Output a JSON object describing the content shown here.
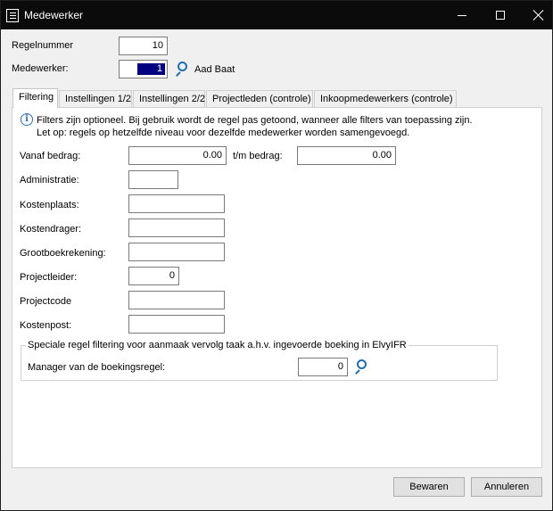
{
  "window": {
    "title": "Medewerker"
  },
  "header": {
    "regelnummer_label": "Regelnummer",
    "regelnummer_value": "10",
    "medewerker_label": "Medewerker:",
    "medewerker_value": "1",
    "medewerker_name": "Aad Baat"
  },
  "tabs": [
    {
      "label": "Filtering",
      "active": true
    },
    {
      "label": "Instellingen 1/2"
    },
    {
      "label": "Instellingen 2/2"
    },
    {
      "label": "Projectleden (controle)"
    },
    {
      "label": "Inkoopmedewerkers (controle)"
    }
  ],
  "info": {
    "line1": "Filters zijn optioneel. Bij gebruik wordt de regel pas getoond, wanneer alle filters van toepassing zijn.",
    "line2": "Let op: regels op hetzelfde niveau voor dezelfde medewerker worden samengevoegd."
  },
  "form": {
    "vanaf_bedrag_label": "Vanaf bedrag:",
    "vanaf_bedrag_value": "0.00",
    "tm_bedrag_label": "t/m bedrag:",
    "tm_bedrag_value": "0.00",
    "administratie_label": "Administratie:",
    "administratie_value": "",
    "kostenplaats_label": "Kostenplaats:",
    "kostenplaats_value": "",
    "kostendrager_label": "Kostendrager:",
    "kostendrager_value": "",
    "grootboekrekening_label": "Grootboekrekening:",
    "grootboekrekening_value": "",
    "projectleider_label": "Projectleider:",
    "projectleider_value": "0",
    "projectcode_label": "Projectcode",
    "projectcode_value": "",
    "kostenpost_label": "Kostenpost:",
    "kostenpost_value": ""
  },
  "special": {
    "group_title": "Speciale regel filtering voor aanmaak vervolg taak a.h.v. ingevoerde boeking in ElvyIFR",
    "manager_label": "Manager van de boekingsregel:",
    "manager_value": "0"
  },
  "footer": {
    "save_label": "Bewaren",
    "cancel_label": "Annuleren"
  },
  "colors": {
    "titlebar": "#0b0b0b",
    "selection": "#000080",
    "icon_accent": "#1f6fb0"
  }
}
